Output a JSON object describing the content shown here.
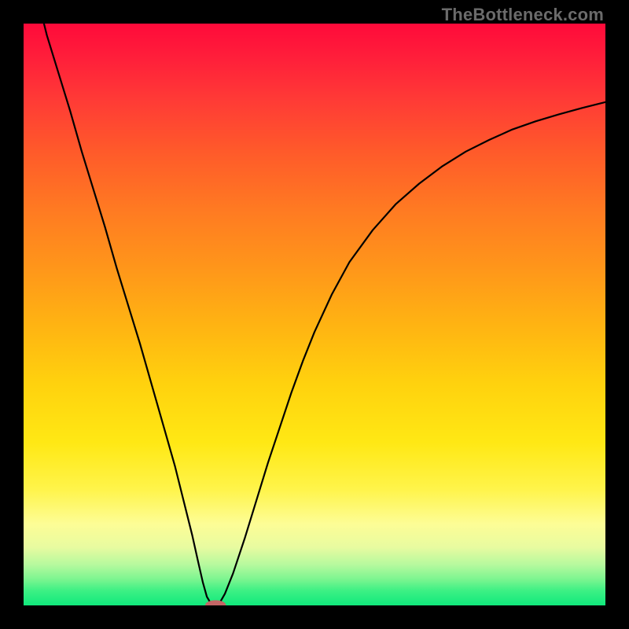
{
  "watermark": "TheBottleneck.com",
  "chart_data": {
    "type": "line",
    "title": "",
    "xlabel": "",
    "ylabel": "",
    "xlim": [
      0,
      100
    ],
    "ylim": [
      0,
      100
    ],
    "grid": false,
    "curve_points": [
      {
        "x": 3.0,
        "y": 102.0
      },
      {
        "x": 4.0,
        "y": 98.0
      },
      {
        "x": 6.0,
        "y": 91.5
      },
      {
        "x": 8.0,
        "y": 85.0
      },
      {
        "x": 10.0,
        "y": 78.0
      },
      {
        "x": 12.0,
        "y": 71.5
      },
      {
        "x": 14.0,
        "y": 65.0
      },
      {
        "x": 16.0,
        "y": 58.0
      },
      {
        "x": 18.0,
        "y": 51.5
      },
      {
        "x": 20.0,
        "y": 45.0
      },
      {
        "x": 22.0,
        "y": 38.0
      },
      {
        "x": 24.0,
        "y": 31.0
      },
      {
        "x": 26.0,
        "y": 24.0
      },
      {
        "x": 27.5,
        "y": 18.0
      },
      {
        "x": 29.0,
        "y": 12.0
      },
      {
        "x": 30.0,
        "y": 7.5
      },
      {
        "x": 30.8,
        "y": 4.0
      },
      {
        "x": 31.5,
        "y": 1.5
      },
      {
        "x": 32.2,
        "y": 0.3
      },
      {
        "x": 33.0,
        "y": 0.2
      },
      {
        "x": 33.8,
        "y": 0.6
      },
      {
        "x": 34.6,
        "y": 2.0
      },
      {
        "x": 36.0,
        "y": 5.5
      },
      {
        "x": 38.0,
        "y": 11.5
      },
      {
        "x": 40.0,
        "y": 18.0
      },
      {
        "x": 42.0,
        "y": 24.5
      },
      {
        "x": 44.0,
        "y": 30.5
      },
      {
        "x": 46.0,
        "y": 36.5
      },
      {
        "x": 48.0,
        "y": 42.0
      },
      {
        "x": 50.0,
        "y": 47.0
      },
      {
        "x": 53.0,
        "y": 53.5
      },
      {
        "x": 56.0,
        "y": 59.0
      },
      {
        "x": 60.0,
        "y": 64.5
      },
      {
        "x": 64.0,
        "y": 69.0
      },
      {
        "x": 68.0,
        "y": 72.5
      },
      {
        "x": 72.0,
        "y": 75.5
      },
      {
        "x": 76.0,
        "y": 78.0
      },
      {
        "x": 80.0,
        "y": 80.0
      },
      {
        "x": 84.0,
        "y": 81.8
      },
      {
        "x": 88.0,
        "y": 83.2
      },
      {
        "x": 92.0,
        "y": 84.4
      },
      {
        "x": 96.0,
        "y": 85.5
      },
      {
        "x": 100.0,
        "y": 86.5
      }
    ],
    "marker": {
      "x": 33.0,
      "y": 0.0,
      "rx": 1.8,
      "ry": 0.9
    }
  }
}
